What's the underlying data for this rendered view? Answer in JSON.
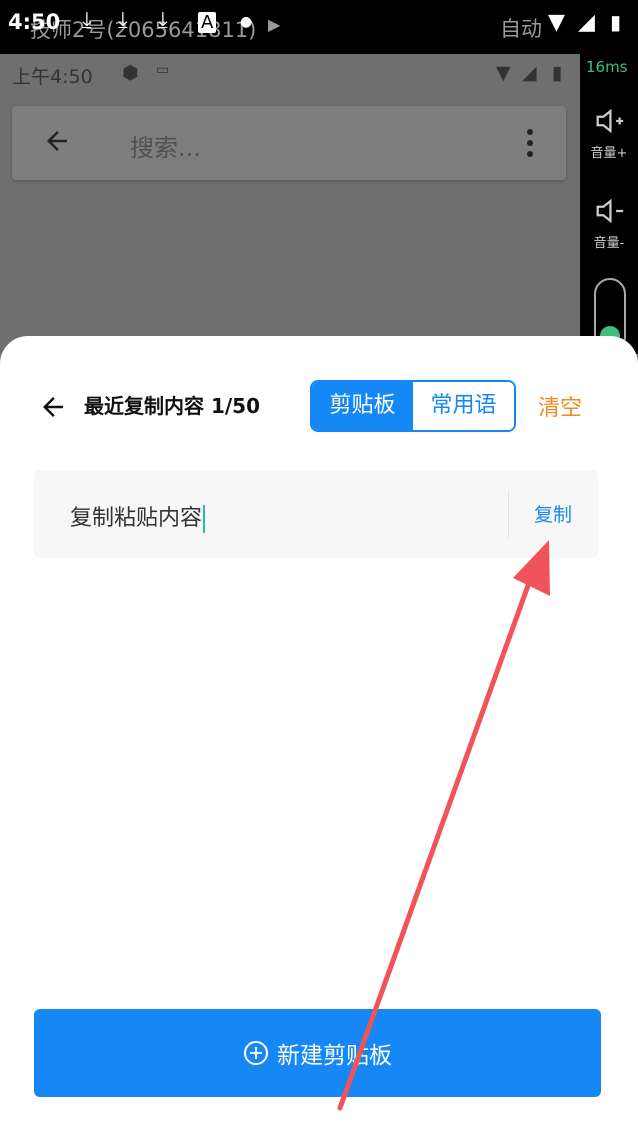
{
  "outer_status": {
    "time": "4:50",
    "overlay_title": "技师2号(2065641811)",
    "mode": "自动"
  },
  "side_panel": {
    "fps": "16ms",
    "volume_up": "音量+",
    "volume_down": "音量-"
  },
  "inner_app": {
    "status_time": "上午4:50",
    "search_placeholder": "搜索..."
  },
  "sheet": {
    "title": "最近复制内容 1/50",
    "tabs": [
      {
        "label": "剪贴板",
        "active": true
      },
      {
        "label": "常用语",
        "active": false
      }
    ],
    "clear_label": "清空",
    "items": [
      {
        "text": "复制粘贴内容",
        "action": "复制"
      }
    ],
    "new_button_label": "新建剪贴板"
  },
  "colors": {
    "accent": "#1588f5",
    "clear": "#f08a24",
    "annotation_arrow": "#f0545a"
  }
}
